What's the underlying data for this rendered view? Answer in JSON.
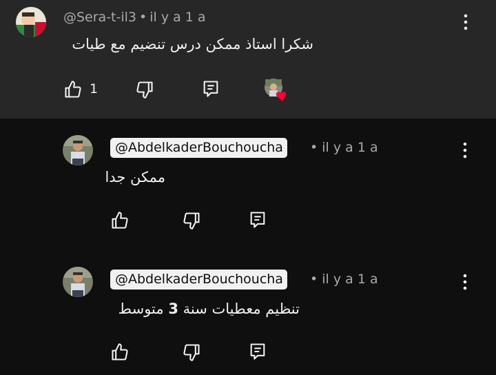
{
  "comments": [
    {
      "author": "@Sera-t-il3",
      "time": "il y a 1 a",
      "text": "شكرا استاذ ممكن درس تنضيم مع طيات",
      "likes": "1"
    },
    {
      "author": "@AbdelkaderBouchoucha",
      "time": "il y a 1 a",
      "text": "ممكن جدا"
    },
    {
      "author": "@AbdelkaderBouchoucha",
      "time": "il y a 1 a",
      "text_before": "تنظيم معطيات سنة ",
      "text_num": "3",
      "text_after": " متوسط"
    }
  ],
  "separator": "•",
  "colors": {
    "top_bg": "#272727",
    "page_bg": "#0f0f0f",
    "heart": "#ff0033"
  }
}
